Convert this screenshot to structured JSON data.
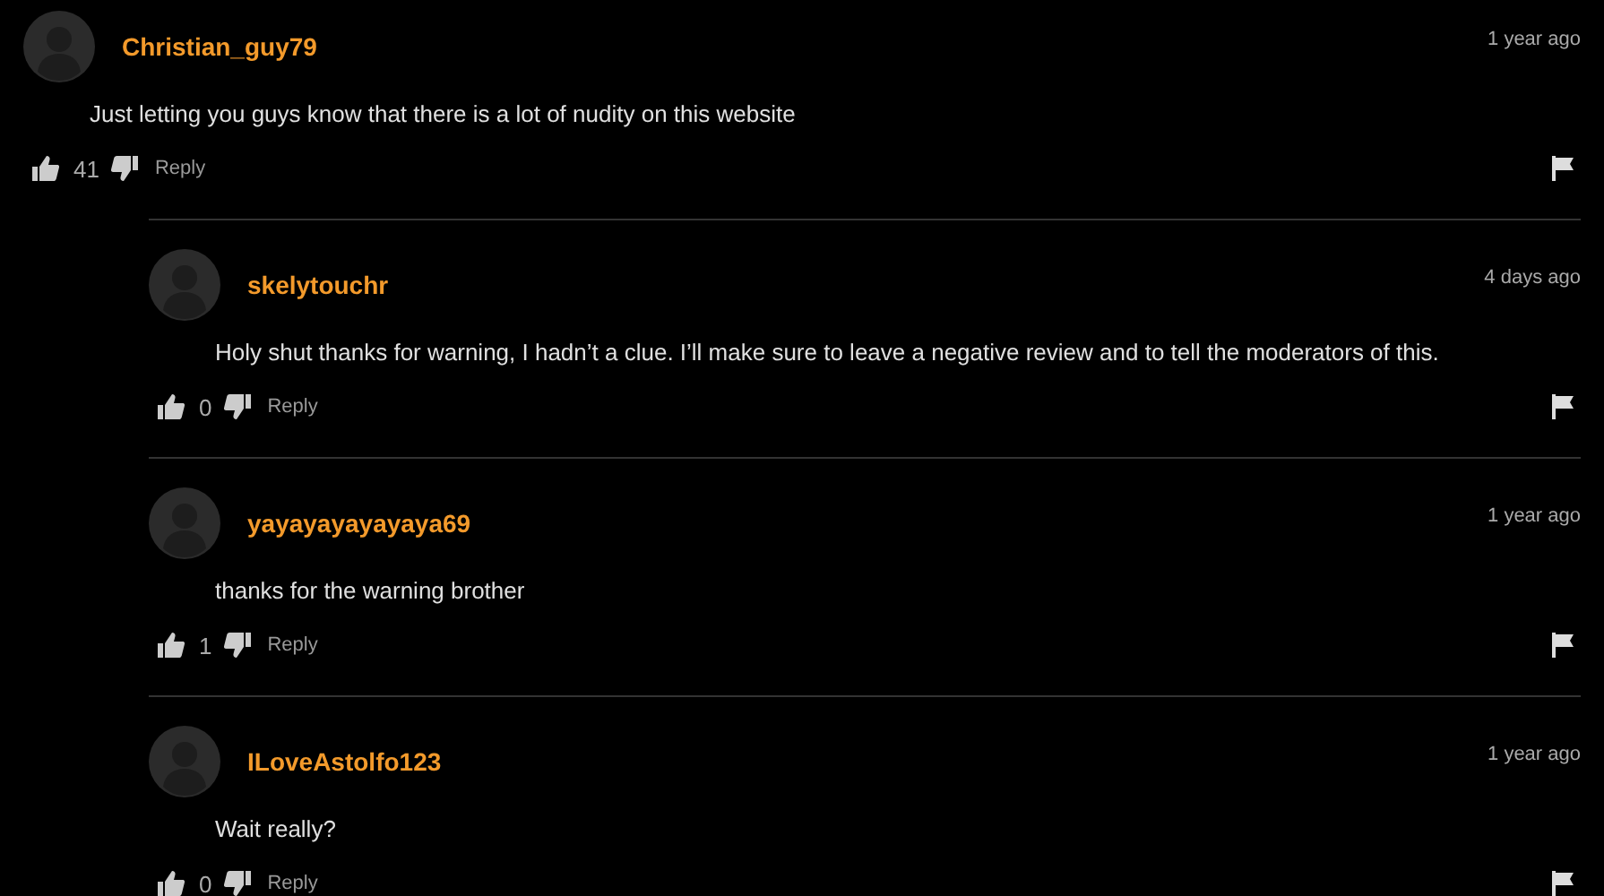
{
  "comments": [
    {
      "author": "Christian_guy79",
      "time": "1 year ago",
      "text": "Just letting you guys know that there is a lot of nudity on this website",
      "likes": "41",
      "reply_label": "Reply",
      "replies": [
        {
          "author": "skelytouchr",
          "time": "4 days ago",
          "text": "Holy shut thanks for warning, I hadn’t a clue. I’ll make sure to leave a negative review and to tell the moderators of this.",
          "likes": "0",
          "reply_label": "Reply"
        },
        {
          "author": "yayayayayayaya69",
          "time": "1 year ago",
          "text": "thanks for the warning brother",
          "likes": "1",
          "reply_label": "Reply"
        },
        {
          "author": "ILoveAstolfo123",
          "time": "1 year ago",
          "text": "Wait really?",
          "likes": "0",
          "reply_label": "Reply"
        }
      ]
    }
  ]
}
